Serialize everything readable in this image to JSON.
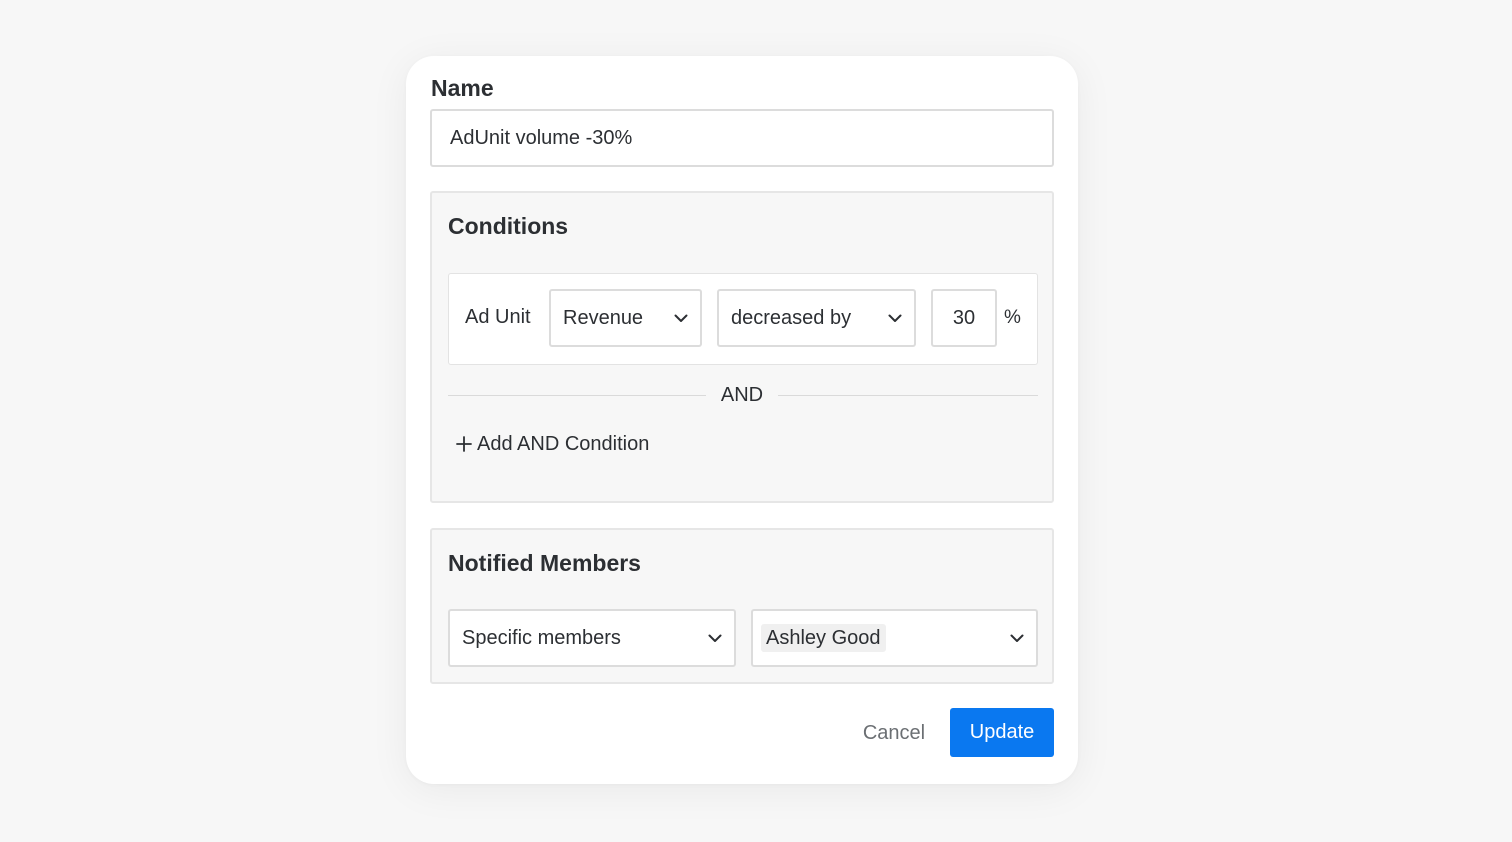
{
  "form": {
    "name_label": "Name",
    "name_value": "AdUnit volume -30%",
    "name_placeholder": ""
  },
  "conditions": {
    "title": "Conditions",
    "rows": [
      {
        "subject": "Ad Unit",
        "metric": "Revenue",
        "operator": "decreased by",
        "value": "30",
        "unit": "%"
      }
    ],
    "and_separator": "AND",
    "add_condition_label": "Add AND Condition"
  },
  "notified_members": {
    "title": "Notified Members",
    "scope": "Specific members",
    "member": "Ashley Good"
  },
  "actions": {
    "cancel_label": "Cancel",
    "update_label": "Update"
  },
  "colors": {
    "primary": "#0a78f0",
    "panel_bg": "#f7f7f7",
    "text": "#2c2f33"
  },
  "icons": {
    "dropdown": "chevron-down-icon",
    "add": "plus-icon"
  }
}
